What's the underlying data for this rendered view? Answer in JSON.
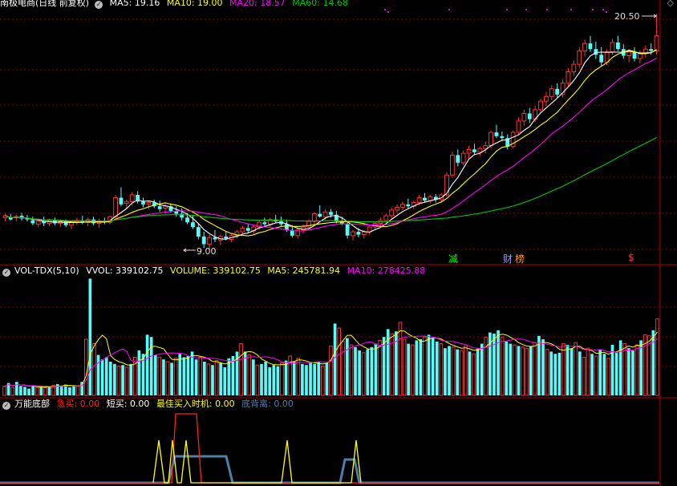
{
  "colors": {
    "up": "#ff3232",
    "down": "#54fcfc",
    "ma5": "#ffffff",
    "ma10": "#ffff00",
    "ma20": "#ff00ff",
    "ma60": "#00c800",
    "grid": "#8b0000",
    "sep": "#b00000"
  },
  "price_panel": {
    "stock_name": "南极电商",
    "mode": "(日线 前复权)",
    "ma5": {
      "label": "MA5:",
      "value": "19.16"
    },
    "ma10": {
      "label": "MA10:",
      "value": "19.00"
    },
    "ma20": {
      "label": "MA20:",
      "value": "18.57"
    },
    "ma60": {
      "label": "MA60:",
      "value": "14.68"
    },
    "high_marker": "20.50",
    "low_marker": "9.00",
    "events": [
      {
        "text": "减",
        "color": "#00ff00"
      },
      {
        "text": "财",
        "color": "#9999ff"
      },
      {
        "text": "榜",
        "color": "#ff9900"
      },
      {
        "text": "$",
        "color": "#ff3232"
      }
    ]
  },
  "volume_panel": {
    "title": "VOL-TDX(5,10)",
    "vvol": {
      "label": "VVOL:",
      "value": "339102.75"
    },
    "volume": {
      "label": "VOLUME:",
      "value": "339102.75"
    },
    "ma5": {
      "label": "MA5:",
      "value": "245781.94"
    },
    "ma10": {
      "label": "MA10:",
      "value": "278425.88"
    }
  },
  "indicator_panel": {
    "title": "万能底部",
    "jimai": {
      "label": "急买:",
      "value": "0.00",
      "color": "#ff2020"
    },
    "duanmai": {
      "label": "短买:",
      "value": "0.00",
      "color": "#ffffff"
    },
    "zuijia": {
      "label": "最佳买入时机:",
      "value": "0.00",
      "color": "#ffff00"
    },
    "dibeili": {
      "label": "底背离:",
      "value": "0.00",
      "color": "#4d7fa8"
    }
  },
  "chart_data": {
    "type": "candlestick",
    "price_range": [
      8.3,
      21.6
    ],
    "volume_range": [
      0,
      525000
    ],
    "candles": [
      [
        10.7,
        10.9,
        10.5,
        10.8
      ],
      [
        10.7,
        10.9,
        10.55,
        10.6
      ],
      [
        10.7,
        10.85,
        10.5,
        10.75
      ],
      [
        10.8,
        10.95,
        10.55,
        10.65
      ],
      [
        10.65,
        10.85,
        10.5,
        10.6
      ],
      [
        10.55,
        10.75,
        10.3,
        10.4
      ],
      [
        10.35,
        10.6,
        10.2,
        10.5
      ],
      [
        10.5,
        10.75,
        10.25,
        10.4
      ],
      [
        10.4,
        10.65,
        10.25,
        10.55
      ],
      [
        10.55,
        10.7,
        10.3,
        10.4
      ],
      [
        10.4,
        10.6,
        10.2,
        10.5
      ],
      [
        10.5,
        10.6,
        10.2,
        10.3
      ],
      [
        10.3,
        10.55,
        10.1,
        10.45
      ],
      [
        10.45,
        10.7,
        10.3,
        10.55
      ],
      [
        10.55,
        10.8,
        10.35,
        10.45
      ],
      [
        10.45,
        10.7,
        10.25,
        10.6
      ],
      [
        10.6,
        10.75,
        10.3,
        10.4
      ],
      [
        10.4,
        10.65,
        10.15,
        10.5
      ],
      [
        10.5,
        10.7,
        10.35,
        10.45
      ],
      [
        10.45,
        10.8,
        10.35,
        10.75
      ],
      [
        10.75,
        11.9,
        10.65,
        11.75
      ],
      [
        11.75,
        12.3,
        11.3,
        11.4
      ],
      [
        11.45,
        11.65,
        11.15,
        11.55
      ],
      [
        11.55,
        12.05,
        11.35,
        11.9
      ],
      [
        11.9,
        12.1,
        11.45,
        11.55
      ],
      [
        11.55,
        11.75,
        11.25,
        11.4
      ],
      [
        11.4,
        11.6,
        11.15,
        11.5
      ],
      [
        11.5,
        11.65,
        11.2,
        11.3
      ],
      [
        11.3,
        11.6,
        11.0,
        11.15
      ],
      [
        11.2,
        11.5,
        10.9,
        11.3
      ],
      [
        11.3,
        11.45,
        10.95,
        11.05
      ],
      [
        11.05,
        11.3,
        10.75,
        10.9
      ],
      [
        10.9,
        11.2,
        10.55,
        10.7
      ],
      [
        10.7,
        10.95,
        10.35,
        10.45
      ],
      [
        10.45,
        10.8,
        10.1,
        10.2
      ],
      [
        10.2,
        10.4,
        9.55,
        9.7
      ],
      [
        9.7,
        9.95,
        9.1,
        9.3
      ],
      [
        9.3,
        9.8,
        9.0,
        9.65
      ],
      [
        9.65,
        10.05,
        9.4,
        9.55
      ],
      [
        9.5,
        9.8,
        9.25,
        9.7
      ],
      [
        9.7,
        9.95,
        9.5,
        9.6
      ],
      [
        9.55,
        9.85,
        9.4,
        9.75
      ],
      [
        9.75,
        10.05,
        9.6,
        9.95
      ],
      [
        9.95,
        10.25,
        9.8,
        10.15
      ],
      [
        10.15,
        10.4,
        9.9,
        10.0
      ],
      [
        10.0,
        10.3,
        9.8,
        10.2
      ],
      [
        10.2,
        10.55,
        10.05,
        10.45
      ],
      [
        10.45,
        10.7,
        10.2,
        10.35
      ],
      [
        10.35,
        10.7,
        10.2,
        10.6
      ],
      [
        10.6,
        10.85,
        10.4,
        10.5
      ],
      [
        10.5,
        10.75,
        10.25,
        10.35
      ],
      [
        10.35,
        10.6,
        9.95,
        10.05
      ],
      [
        10.05,
        10.3,
        9.65,
        9.75
      ],
      [
        9.75,
        10.15,
        9.6,
        10.05
      ],
      [
        10.05,
        10.35,
        9.85,
        10.2
      ],
      [
        10.2,
        10.6,
        10.1,
        10.5
      ],
      [
        10.5,
        11.0,
        10.35,
        10.9
      ],
      [
        10.9,
        11.35,
        10.7,
        10.75
      ],
      [
        10.75,
        11.15,
        10.6,
        11.0
      ],
      [
        11.0,
        11.15,
        10.7,
        10.85
      ],
      [
        10.85,
        11.05,
        10.4,
        10.5
      ],
      [
        10.5,
        10.75,
        10.3,
        10.35
      ],
      [
        10.35,
        10.5,
        9.6,
        9.75
      ],
      [
        9.75,
        10.05,
        9.5,
        9.95
      ],
      [
        9.95,
        10.15,
        9.65,
        9.8
      ],
      [
        9.8,
        10.05,
        9.6,
        9.95
      ],
      [
        9.95,
        10.3,
        9.8,
        10.2
      ],
      [
        10.2,
        10.5,
        10.05,
        10.4
      ],
      [
        10.4,
        10.7,
        10.25,
        10.55
      ],
      [
        10.55,
        10.9,
        10.45,
        10.8
      ],
      [
        10.8,
        11.25,
        10.65,
        11.1
      ],
      [
        11.1,
        11.4,
        10.95,
        11.25
      ],
      [
        11.25,
        11.55,
        11.1,
        11.4
      ],
      [
        11.4,
        11.7,
        11.2,
        11.3
      ],
      [
        11.3,
        11.6,
        11.15,
        11.5
      ],
      [
        11.5,
        11.9,
        11.35,
        11.75
      ],
      [
        11.75,
        12.0,
        11.5,
        11.6
      ],
      [
        11.6,
        11.9,
        11.45,
        11.8
      ],
      [
        11.8,
        11.95,
        11.5,
        11.65
      ],
      [
        11.65,
        12.0,
        11.5,
        11.9
      ],
      [
        11.9,
        13.1,
        11.8,
        12.95
      ],
      [
        12.95,
        14.2,
        12.8,
        14.0
      ],
      [
        14.0,
        14.3,
        13.4,
        13.6
      ],
      [
        13.6,
        14.25,
        13.45,
        14.1
      ],
      [
        14.1,
        14.5,
        13.8,
        14.3
      ],
      [
        14.3,
        14.6,
        14.0,
        14.15
      ],
      [
        14.15,
        14.45,
        13.95,
        14.35
      ],
      [
        14.35,
        14.7,
        14.1,
        14.5
      ],
      [
        14.5,
        15.3,
        14.35,
        15.2
      ],
      [
        15.2,
        15.6,
        14.9,
        15.0
      ],
      [
        15.0,
        15.25,
        14.75,
        14.9
      ],
      [
        14.9,
        15.1,
        14.3,
        14.45
      ],
      [
        14.45,
        15.3,
        14.35,
        15.2
      ],
      [
        15.2,
        16.0,
        15.1,
        15.8
      ],
      [
        15.8,
        16.4,
        15.55,
        16.2
      ],
      [
        16.2,
        16.5,
        15.7,
        15.9
      ],
      [
        15.9,
        16.6,
        15.75,
        16.4
      ],
      [
        16.4,
        17.0,
        16.25,
        16.85
      ],
      [
        16.85,
        17.35,
        16.6,
        17.1
      ],
      [
        17.1,
        17.7,
        16.9,
        17.5
      ],
      [
        17.5,
        17.8,
        17.05,
        17.2
      ],
      [
        17.2,
        18.0,
        17.05,
        17.8
      ],
      [
        17.8,
        18.6,
        17.65,
        18.4
      ],
      [
        18.4,
        19.0,
        18.2,
        18.8
      ],
      [
        18.8,
        19.7,
        18.6,
        19.5
      ],
      [
        19.5,
        20.1,
        19.2,
        19.9
      ],
      [
        19.9,
        20.3,
        19.45,
        19.6
      ],
      [
        19.6,
        20.0,
        19.1,
        19.3
      ],
      [
        19.3,
        19.7,
        18.7,
        18.9
      ],
      [
        18.9,
        19.6,
        18.75,
        19.45
      ],
      [
        19.45,
        20.15,
        19.3,
        19.95
      ],
      [
        19.95,
        20.3,
        19.5,
        19.6
      ],
      [
        19.6,
        19.85,
        19.1,
        19.25
      ],
      [
        19.25,
        19.6,
        18.9,
        19.45
      ],
      [
        19.45,
        19.7,
        18.95,
        19.1
      ],
      [
        19.1,
        19.55,
        18.85,
        19.4
      ],
      [
        19.4,
        19.8,
        19.15,
        19.6
      ],
      [
        19.6,
        19.9,
        19.3,
        19.5
      ],
      [
        19.5,
        21.45,
        19.3,
        20.3
      ]
    ],
    "volumes": [
      40000,
      55000,
      35000,
      60000,
      42000,
      38000,
      30000,
      45000,
      36000,
      40000,
      34000,
      38000,
      45000,
      50000,
      42000,
      48000,
      36000,
      44000,
      40000,
      60000,
      250000,
      520000,
      230000,
      180000,
      160000,
      170000,
      150000,
      140000,
      130000,
      135000,
      125000,
      140000,
      170000,
      200000,
      185000,
      270000,
      260000,
      180000,
      170000,
      160000,
      150000,
      145000,
      165000,
      185000,
      170000,
      175000,
      195000,
      160000,
      170000,
      150000,
      140000,
      135000,
      155000,
      145000,
      125000,
      165000,
      175000,
      195000,
      230000,
      195000,
      180000,
      160000,
      135000,
      140000,
      150000,
      125000,
      135000,
      130000,
      145000,
      155000,
      175000,
      150000,
      165000,
      140000,
      135000,
      145000,
      140000,
      150000,
      130000,
      145000,
      220000,
      320000,
      300000,
      240000,
      255000,
      225000,
      215000,
      200000,
      190000,
      205000,
      215000,
      230000,
      245000,
      260000,
      295000,
      275000,
      285000,
      325000,
      250000,
      230000,
      225000,
      245000,
      250000,
      260000,
      270000,
      255000,
      240000,
      230000,
      210000,
      220000,
      215000,
      205000,
      200000,
      220000,
      195000,
      185000,
      210000,
      230000,
      260000,
      280000,
      275000,
      290000,
      260000,
      240000,
      230000,
      225000,
      220000,
      215000,
      210000,
      220000,
      235000,
      265000,
      250000,
      205000,
      195000,
      185000,
      190000,
      230000,
      225000,
      210000,
      235000,
      195000,
      170000,
      210000,
      185000,
      175000,
      205000,
      185000,
      165000,
      225000,
      190000,
      245000,
      230000,
      210000,
      200000,
      225000,
      245000,
      270000,
      265000,
      290000,
      340000
    ]
  }
}
